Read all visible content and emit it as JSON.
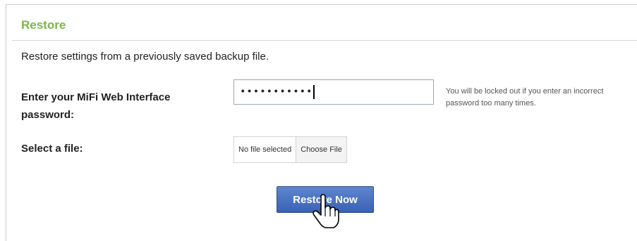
{
  "section": {
    "title": "Restore",
    "description": "Restore settings from a previously saved backup file."
  },
  "password": {
    "label": "Enter your MiFi Web Interface password:",
    "masked_value": "•••••••••••",
    "warning": "You will be locked out if you enter an incorrect password too many times."
  },
  "file": {
    "label": "Select a file:",
    "status": "No file selected",
    "choose_label": "Choose File"
  },
  "actions": {
    "restore_label": "Restore Now"
  },
  "colors": {
    "title_green": "#7ab648",
    "button_blue": "#3a62b3"
  },
  "icons": {
    "cursor": "hand-pointer-icon"
  }
}
